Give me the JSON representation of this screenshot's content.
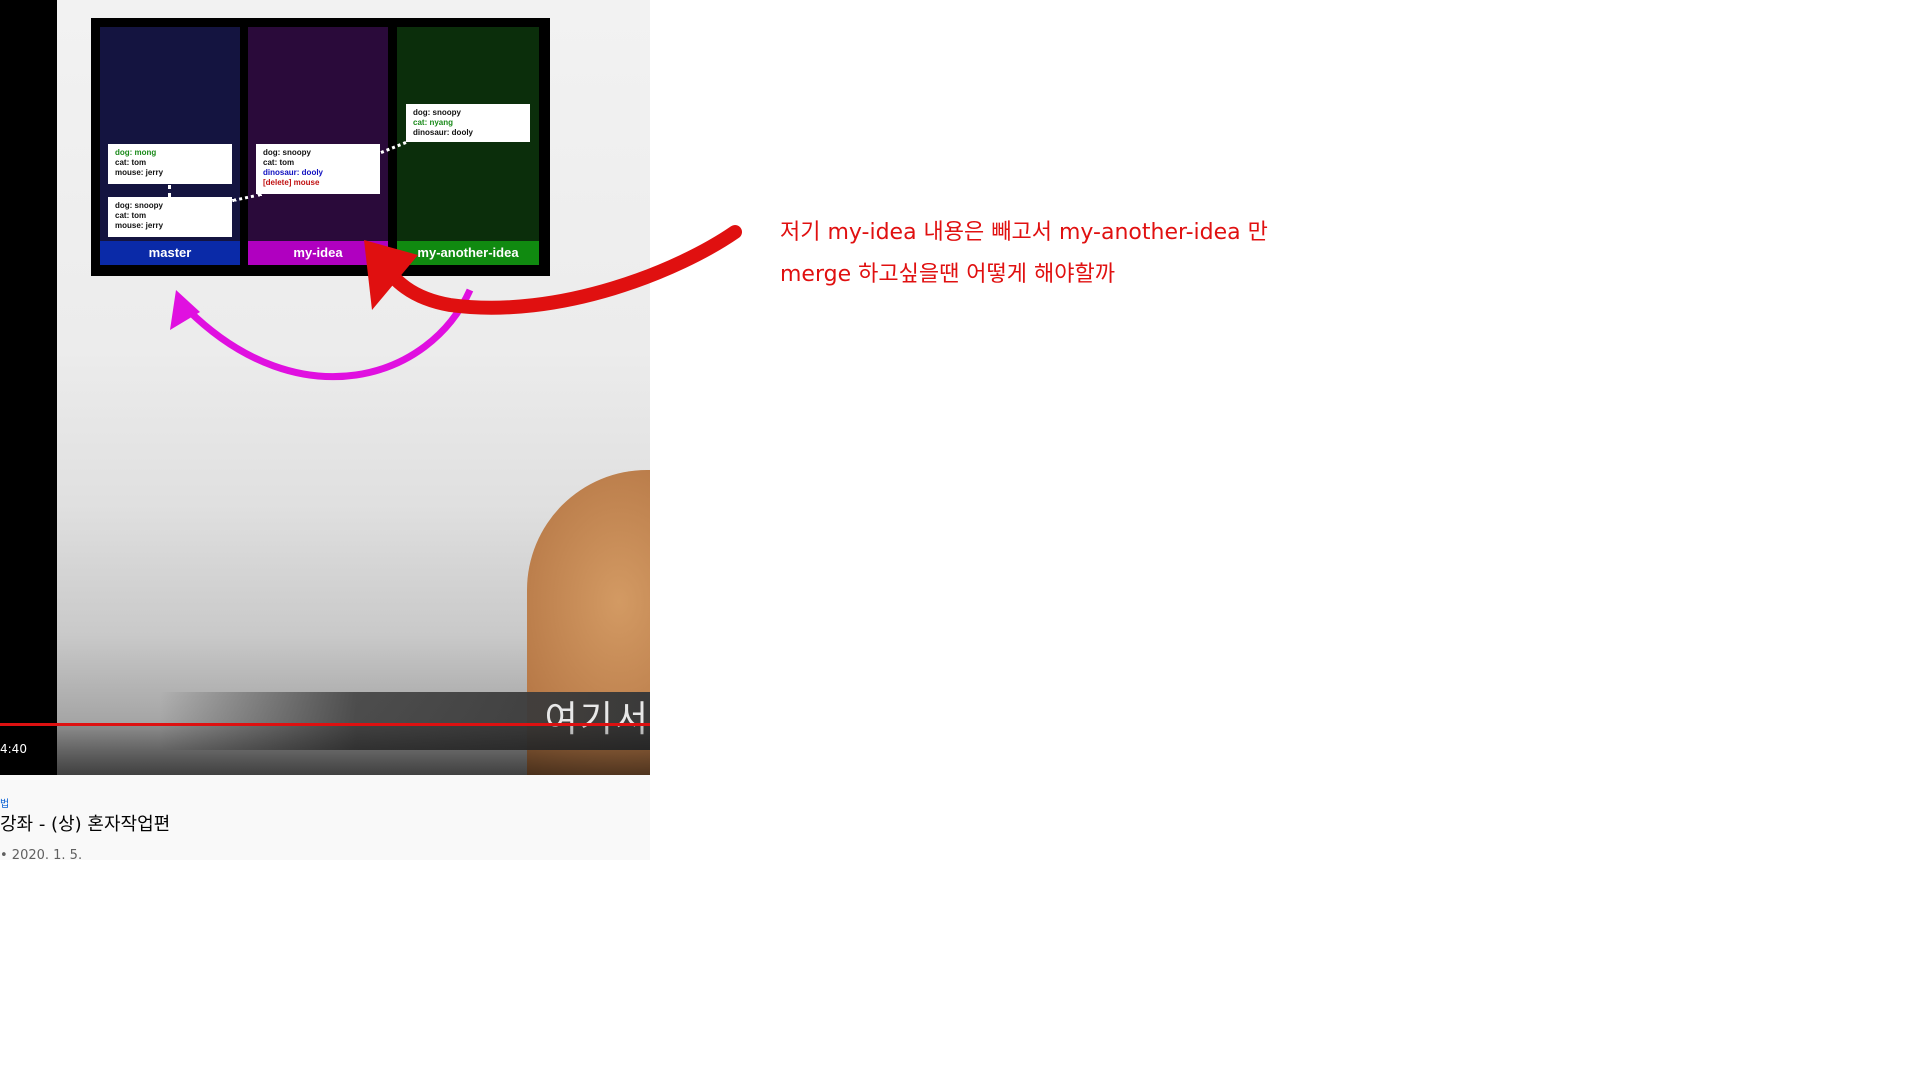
{
  "video": {
    "current_time": "4:40",
    "caption": "여기서",
    "channel": "법",
    "title": "강좌 - (상) 혼자작업편",
    "meta": "• 2020. 1. 5."
  },
  "diagram": {
    "columns": [
      {
        "label": "master",
        "bg": "#141440",
        "label_bg": "#0a2aa8"
      },
      {
        "label": "my-idea",
        "bg": "#2a0a3a",
        "label_bg": "#b000c0"
      },
      {
        "label": "my-another-idea",
        "bg": "#0b2e0b",
        "label_bg": "#108a10"
      }
    ],
    "master_card_top": [
      "dog: mong",
      "cat: tom",
      "mouse: jerry"
    ],
    "master_card_bottom": [
      "dog: snoopy",
      "cat: tom",
      "mouse: jerry"
    ],
    "myidea_card": [
      "dog: snoopy",
      "cat: tom",
      "dinosaur: dooly",
      "[delete] mouse"
    ],
    "another_card": [
      "dog: snoopy",
      "cat: nyang",
      "dinosaur: dooly"
    ]
  },
  "annotation": {
    "line1": "저기 my-idea 내용은 빼고서 my-another-idea 만",
    "line2": "merge 하고싶을땐 어떻게 해야할까",
    "color": "#e01010"
  },
  "colors": {
    "magenta_arrow": "#e010e0",
    "red_arrow": "#e01010",
    "progress": "#dd1111"
  }
}
